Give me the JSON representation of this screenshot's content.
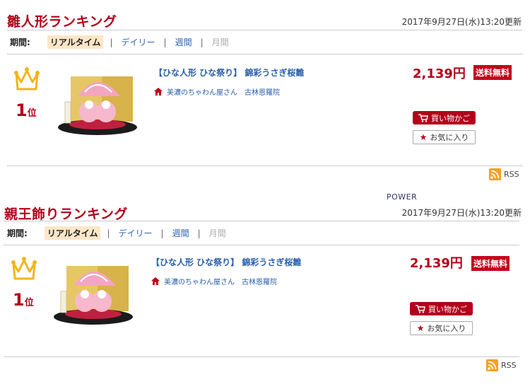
{
  "power_label": "POWER",
  "sections": [
    {
      "title": "雛人形ランキング",
      "updated": "2017年9月27日(水)13:20更新",
      "period_label": "期間:",
      "tabs": [
        "リアルタイム",
        "デイリー",
        "週間",
        "月間"
      ],
      "active_tab": "リアルタイム",
      "disabled_tab": "月間",
      "item": {
        "rank_number": "1",
        "rank_unit": "位",
        "title": "【ひな人形 ひな祭り】 錦彩うさぎ桜雛",
        "shop_name": "美濃のちゃわん屋さん",
        "shop_name_2": "古林恩羅院",
        "price": "2,139円",
        "shipping_badge": "送料無料",
        "cart_label": "買い物かご",
        "favorite_label": "お気に入り"
      },
      "rss_label": "RSS"
    },
    {
      "title": "親王飾りランキング",
      "updated": "2017年9月27日(水)13:20更新",
      "period_label": "期間:",
      "tabs": [
        "リアルタイム",
        "デイリー",
        "週間",
        "月間"
      ],
      "active_tab": "リアルタイム",
      "disabled_tab": "月間",
      "item": {
        "rank_number": "1",
        "rank_unit": "位",
        "title": "【ひな人形 ひな祭り】 錦彩うさぎ桜雛",
        "shop_name": "美濃のちゃわん屋さん",
        "shop_name_2": "古林恩羅院",
        "price": "2,139円",
        "shipping_badge": "送料無料",
        "cart_label": "買い物かご",
        "favorite_label": "お気に入り"
      },
      "rss_label": "RSS"
    }
  ],
  "colors": {
    "accent_red": "#b3001b",
    "link_blue": "#2b5fa8",
    "active_tab_bg": "#fde6c8",
    "crown_gold": "#f2b51a",
    "rss_orange": "#f7a022"
  }
}
